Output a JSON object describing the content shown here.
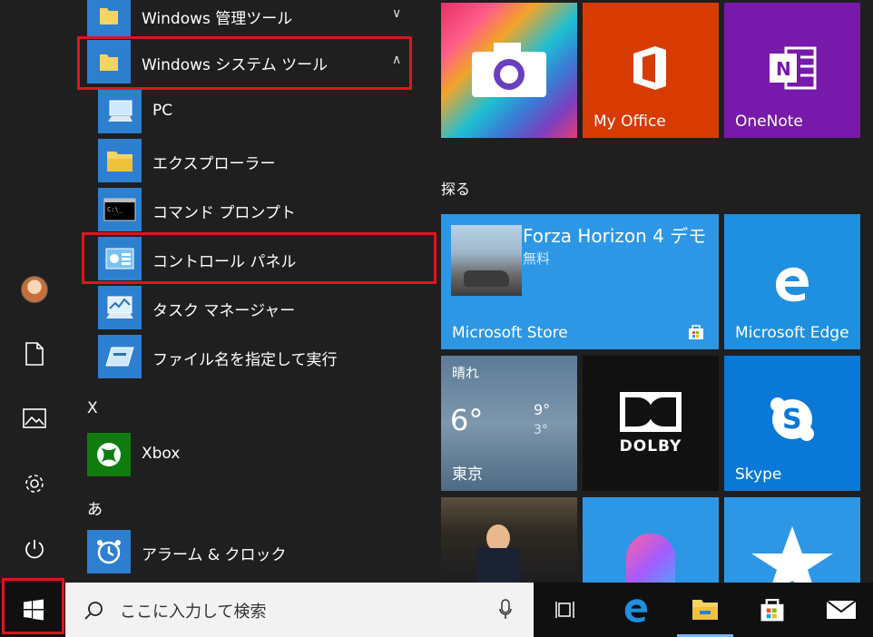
{
  "app_list": {
    "items": [
      {
        "name": "Windows 管理ツール",
        "chevron": "∨"
      },
      {
        "name": "Windows システム ツール",
        "chevron": "∧"
      },
      {
        "name": "PC"
      },
      {
        "name": "エクスプローラー"
      },
      {
        "name": "コマンド プロンプト"
      },
      {
        "name": "コントロール パネル"
      },
      {
        "name": "タスク マネージャー"
      },
      {
        "name": "ファイル名を指定して実行"
      },
      {
        "name": "Xbox"
      },
      {
        "name": "アラーム & クロック"
      }
    ],
    "group_x": "X",
    "group_a": "あ"
  },
  "tiles": {
    "camera": {
      "label": ""
    },
    "my_office": {
      "label": "My Office"
    },
    "onenote": {
      "label": "OneNote"
    },
    "section_title": "探る",
    "store": {
      "title": "Forza Horizon 4 デモ",
      "subtitle": "無料",
      "label": "Microsoft Store"
    },
    "edge": {
      "label": "Microsoft Edge"
    },
    "weather": {
      "condition": "晴れ",
      "temp": "6°",
      "high": "9°",
      "low": "3°",
      "city": "東京"
    },
    "dolby": {
      "label": "DOLBY"
    },
    "skype": {
      "label": "Skype"
    }
  },
  "search": {
    "placeholder": "ここに入力して検索"
  },
  "colors": {
    "highlight": "#e0141e",
    "office": "#d83b01",
    "onenote": "#7719aa",
    "tile_blue": "#1f8fe0",
    "skype": "#0a78d7"
  }
}
